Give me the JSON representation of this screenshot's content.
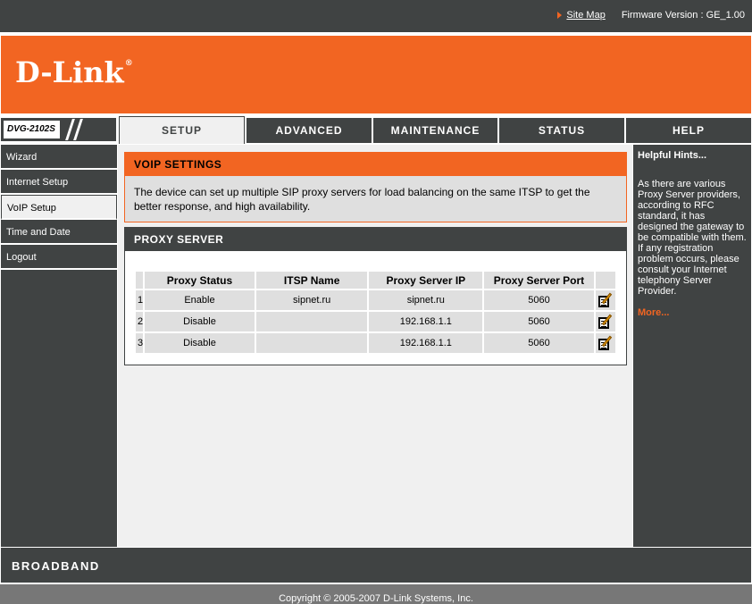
{
  "topbar": {
    "site_map": "Site Map",
    "firmware": "Firmware Version : GE_1.00"
  },
  "brand": {
    "logo": "D-Link",
    "registered": "®",
    "model": "DVG-2102S"
  },
  "tabs": [
    {
      "label": "SETUP",
      "active": true
    },
    {
      "label": "ADVANCED",
      "active": false
    },
    {
      "label": "MAINTENANCE",
      "active": false
    },
    {
      "label": "STATUS",
      "active": false
    },
    {
      "label": "HELP",
      "active": false
    }
  ],
  "sidebar": {
    "items": [
      {
        "label": "Wizard",
        "active": false
      },
      {
        "label": "Internet Setup",
        "active": false
      },
      {
        "label": "VoIP Setup",
        "active": true
      },
      {
        "label": "Time and Date",
        "active": false
      },
      {
        "label": "Logout",
        "active": false
      }
    ]
  },
  "voip": {
    "title": "VOIP SETTINGS",
    "description": "The device can set up multiple SIP proxy servers for load balancing on the same ITSP to get the better response, and high availability."
  },
  "proxy": {
    "title": "PROXY SERVER",
    "headers": [
      "Proxy Status",
      "ITSP Name",
      "Proxy Server IP",
      "Proxy Server Port"
    ],
    "rows": [
      {
        "num": "1",
        "status": "Enable",
        "itsp": "sipnet.ru",
        "ip": "sipnet.ru",
        "port": "5060"
      },
      {
        "num": "2",
        "status": "Disable",
        "itsp": "",
        "ip": "192.168.1.1",
        "port": "5060"
      },
      {
        "num": "3",
        "status": "Disable",
        "itsp": "",
        "ip": "192.168.1.1",
        "port": "5060"
      }
    ]
  },
  "hints": {
    "title": "Helpful Hints...",
    "text": "As there are various Proxy Server providers, according to RFC standard, it has designed the gateway to be compatible with them. If any registration problem occurs, please consult your Internet telephony Server Provider.",
    "more": "More..."
  },
  "footer": {
    "brand": "BROADBAND",
    "copyright": "Copyright © 2005-2007 D-Link Systems, Inc."
  },
  "colors": {
    "accent": "#f26522",
    "dark": "#404343",
    "panel": "#f0f0f0",
    "cell": "#dfdfdf"
  }
}
